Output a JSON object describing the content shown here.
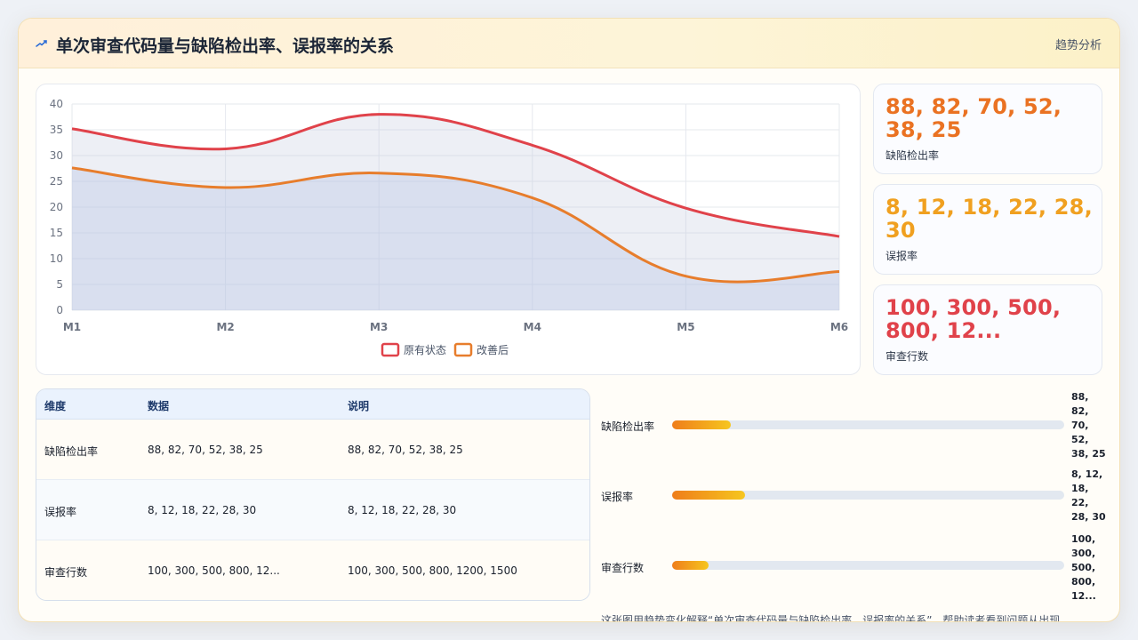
{
  "header": {
    "title": "单次审查代码量与缺陷检出率、误报率的关系",
    "link": "趋势分析"
  },
  "chart_data": {
    "type": "area",
    "x": [
      "M1",
      "M2",
      "M3",
      "M4",
      "M5",
      "M6"
    ],
    "ylim": [
      0,
      40
    ],
    "yticks": [
      0,
      5,
      10,
      15,
      20,
      25,
      30,
      35,
      40
    ],
    "grid": true,
    "legend": "bottom",
    "series": [
      {
        "name": "原有状态",
        "values": [
          35.2,
          31.3,
          38.0,
          32.0,
          19.8,
          14.3
        ],
        "color": "#e0424a"
      },
      {
        "name": "改善后",
        "values": [
          27.6,
          23.8,
          26.6,
          21.8,
          6.6,
          7.5
        ],
        "color": "#e77d2c"
      }
    ]
  },
  "kpis": [
    {
      "value": "88, 82, 70, 52, 38, 25",
      "label": "缺陷检出率",
      "color": "#ea7222"
    },
    {
      "value": "8, 12, 18, 22, 28, 30",
      "label": "误报率",
      "color": "#f0a020"
    },
    {
      "value": "100, 300, 500, 800, 12...",
      "label": "审查行数",
      "color": "#e0424a"
    }
  ],
  "table": {
    "headers": [
      "维度",
      "数据",
      "说明"
    ],
    "rows": [
      [
        "缺陷检出率",
        "88, 82, 70, 52, 38, 25",
        "88, 82, 70, 52, 38, 25"
      ],
      [
        "误报率",
        "8, 12, 18, 22, 28, 30",
        "8, 12, 18, 22, 28, 30"
      ],
      [
        "审查行数",
        "100, 300, 500, 800, 12...",
        "100, 300, 500, 800, 1200, 1500"
      ]
    ]
  },
  "bars": [
    {
      "label": "缺陷检出率",
      "value_lines": [
        "88,",
        "82,",
        "70,",
        "52,",
        "38, 25"
      ],
      "fill": 0.15
    },
    {
      "label": "误报率",
      "value_lines": [
        "8, 12,",
        "18,",
        "22,",
        "28, 30"
      ],
      "fill": 0.185
    },
    {
      "label": "审查行数",
      "value_lines": [
        "100,",
        "300,",
        "500,",
        "800,",
        "12..."
      ],
      "fill": 0.092
    }
  ],
  "note": "这张图用趋势变化解释“单次审查代码量与缺陷检出率、误报率的关系”，帮助读者看到问题从出现"
}
